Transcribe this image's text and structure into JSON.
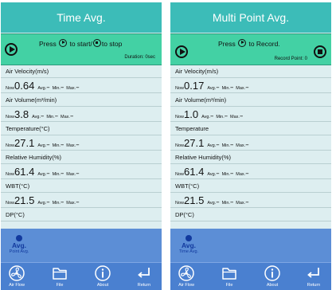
{
  "screens": [
    {
      "title": "Time Avg.",
      "instruction": {
        "before": "Press",
        "middle": " to start/",
        "after": "to stop"
      },
      "sub_info": "Duration: 0sec",
      "params": [
        {
          "label": "Air Velocity(m/s)",
          "now": "0.64"
        },
        {
          "label": "Air Volume(m³/min)",
          "now": "3.8"
        },
        {
          "label": "Temperature(°C)",
          "now": "27.1"
        },
        {
          "label": "Relative Humidity(%)",
          "now": "61.4"
        },
        {
          "label": "WBT(°C)",
          "now": "21.5"
        },
        {
          "label": "DP(°C)",
          "now": ""
        }
      ],
      "mode": {
        "name": "Avg.",
        "sub": "Point Avg."
      }
    },
    {
      "title": "Multi Point Avg.",
      "instruction": {
        "before": "Press",
        "middle": " to Record.",
        "after": ""
      },
      "sub_info": "Record Point: 0",
      "params": [
        {
          "label": "Air Velocity(m/s)",
          "now": "0.17"
        },
        {
          "label": "Air Volume(m³/min)",
          "now": "1.0"
        },
        {
          "label": "Temperature",
          "now": "27.1"
        },
        {
          "label": "Relative Humidity(%)",
          "now": "61.4"
        },
        {
          "label": "WBT(°C)",
          "now": "21.5"
        },
        {
          "label": "DP(°C)",
          "now": ""
        }
      ],
      "mode": {
        "name": "Avg.",
        "sub": "Time Avg."
      }
    }
  ],
  "value_labels": {
    "now": "Now",
    "avg": "Avg.",
    "min": "Min.",
    "max": "Max.",
    "empty": "--"
  },
  "tabs": [
    "Air Flow",
    "File",
    "About",
    "Return"
  ],
  "colors": {
    "title_bar": "#3cbcb8",
    "control_bar": "#43d1a4",
    "list_bg": "#ddeef0",
    "mode_area": "#5c8ed6",
    "tab_bar": "#4a80d0",
    "active_mode": "#123a9e"
  },
  "icons": {
    "play": "play-circle-icon",
    "stop": "stop-circle-icon",
    "tabs": [
      "fan-icon",
      "folder-icon",
      "info-icon",
      "return-icon"
    ]
  }
}
